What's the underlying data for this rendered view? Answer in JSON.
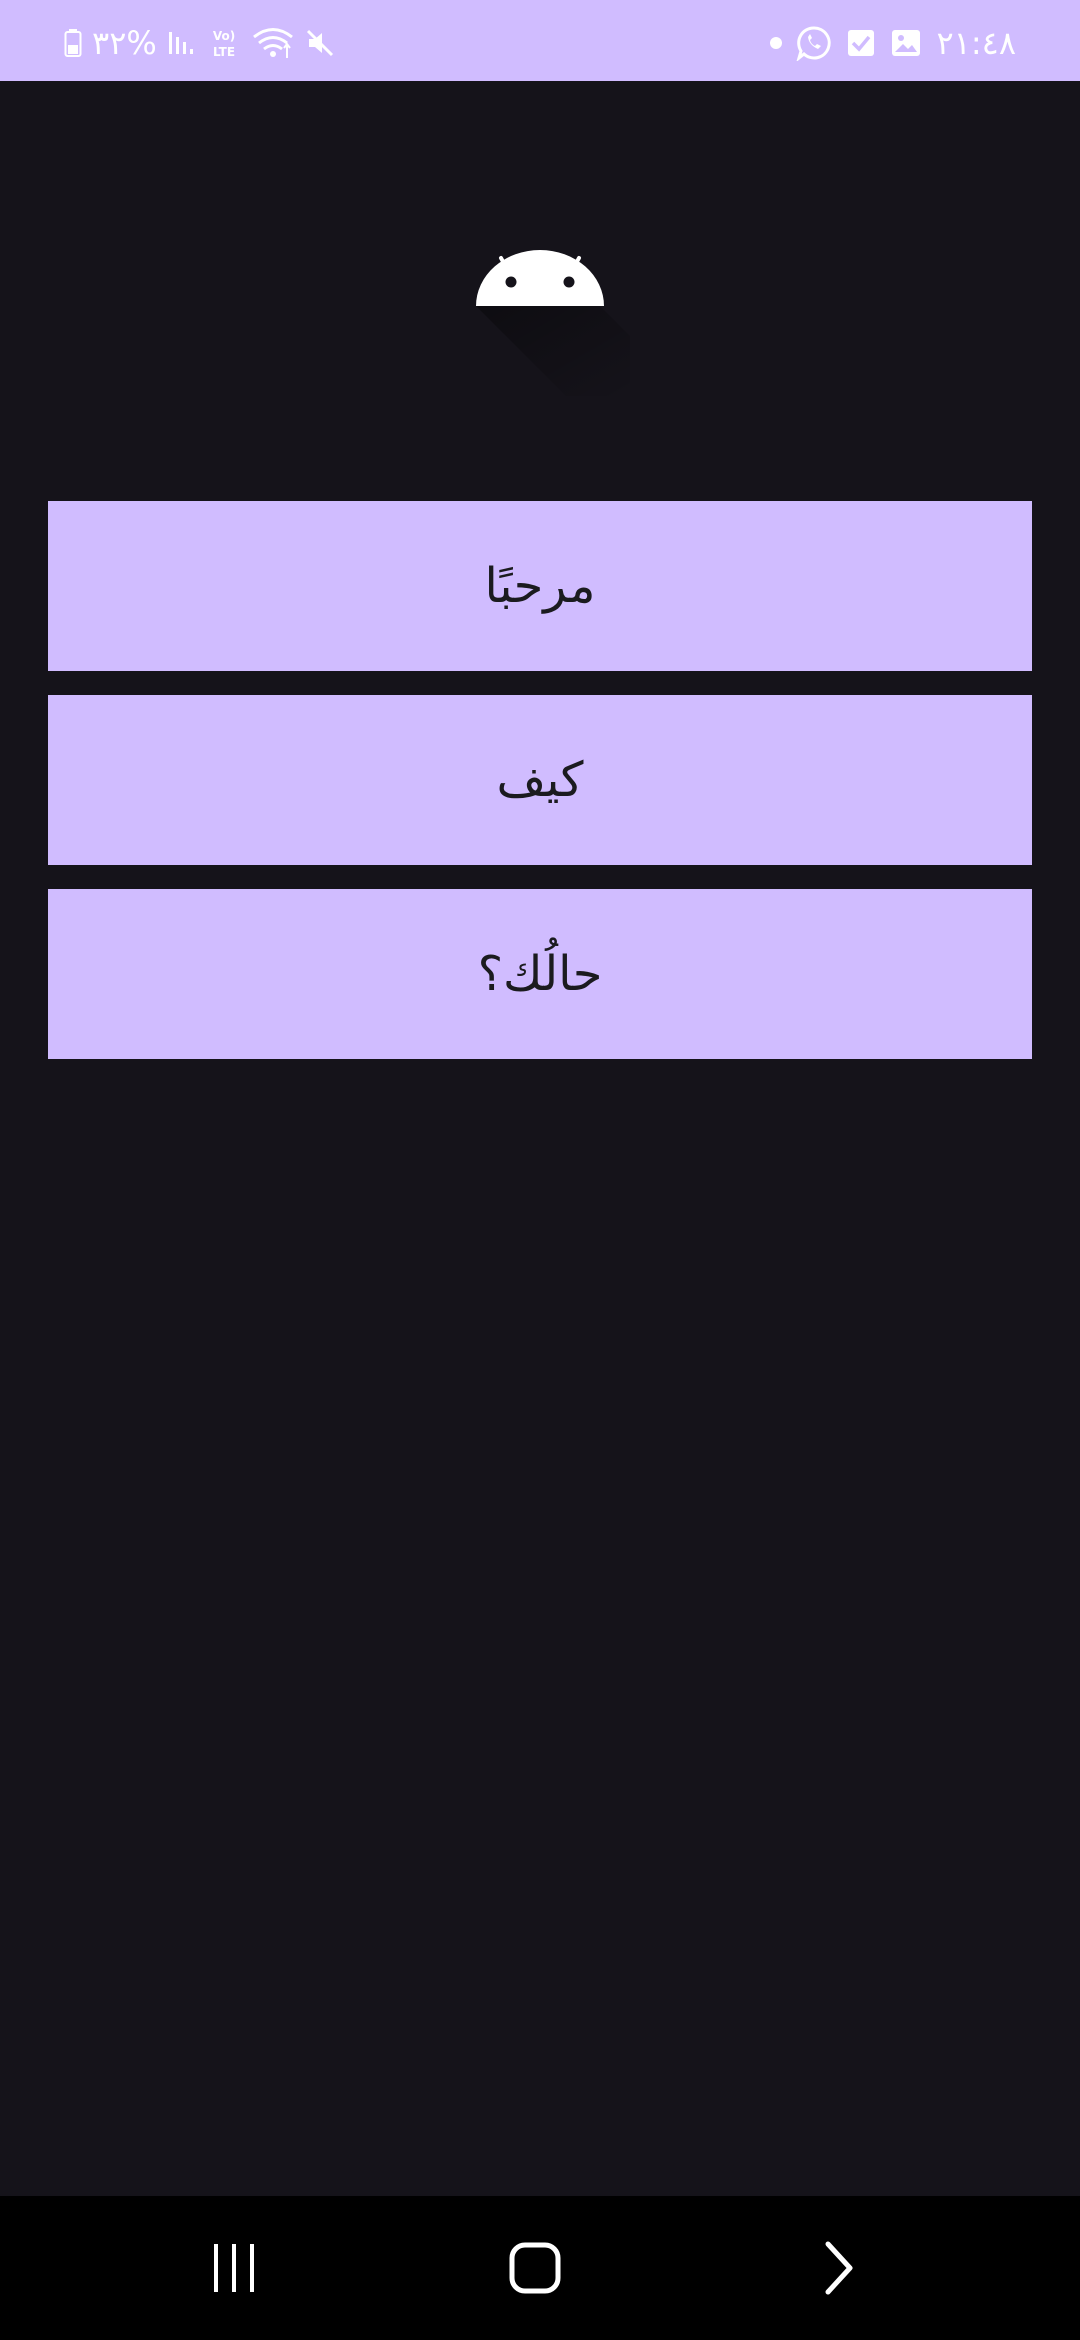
{
  "status_bar": {
    "time": "٢١:٤٨",
    "battery_percent": "٣٢%",
    "network_label": "Vo) LTE",
    "background_color": "#d0bcff",
    "left_icons": [
      "battery-icon",
      "signal-icon",
      "volte-icon",
      "wifi-icon",
      "mute-icon"
    ],
    "right_icons": [
      "notification-dot-icon",
      "whatsapp-icon",
      "checkbox-icon",
      "gallery-icon"
    ]
  },
  "app": {
    "background_color": "#15131a",
    "logo_icon": "android-icon",
    "buttons": [
      {
        "label": "مرحبًا"
      },
      {
        "label": "كيف"
      },
      {
        "label": "حالُك؟"
      }
    ],
    "button_color": "#d0bcff"
  },
  "nav_bar": {
    "buttons": [
      "recents-icon",
      "home-icon",
      "back-icon"
    ]
  }
}
